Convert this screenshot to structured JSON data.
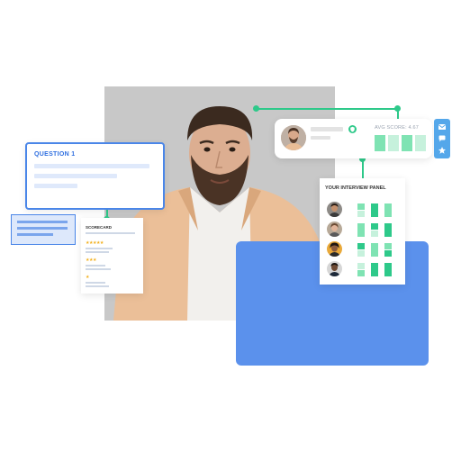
{
  "question_card": {
    "title": "QUESTION 1"
  },
  "scorecard": {
    "title": "SCORECARD",
    "rating_rows": [
      {
        "stars": "★★★★★"
      },
      {
        "stars": "★★★"
      },
      {
        "stars": "★"
      }
    ]
  },
  "profile_card": {
    "avg_score_label": "AVG SCORE: 4.67"
  },
  "interview_panel": {
    "title": "YOUR INTERVIEW PANEL",
    "members": [
      {
        "avatar": "panelist-1-avatar"
      },
      {
        "avatar": "panelist-2-avatar"
      },
      {
        "avatar": "panelist-3-avatar"
      },
      {
        "avatar": "panelist-4-avatar"
      }
    ]
  },
  "toolbar": {
    "icons": [
      "mail-icon",
      "chat-icon",
      "star-icon"
    ]
  },
  "colors": {
    "primary_blue": "#4a86e8",
    "block_blue": "#5b91ec",
    "accent_green": "#2ec98a",
    "score_green": "#7fe3b3",
    "toolbar_blue": "#54a7ea",
    "star_gold": "#f2b01e"
  }
}
